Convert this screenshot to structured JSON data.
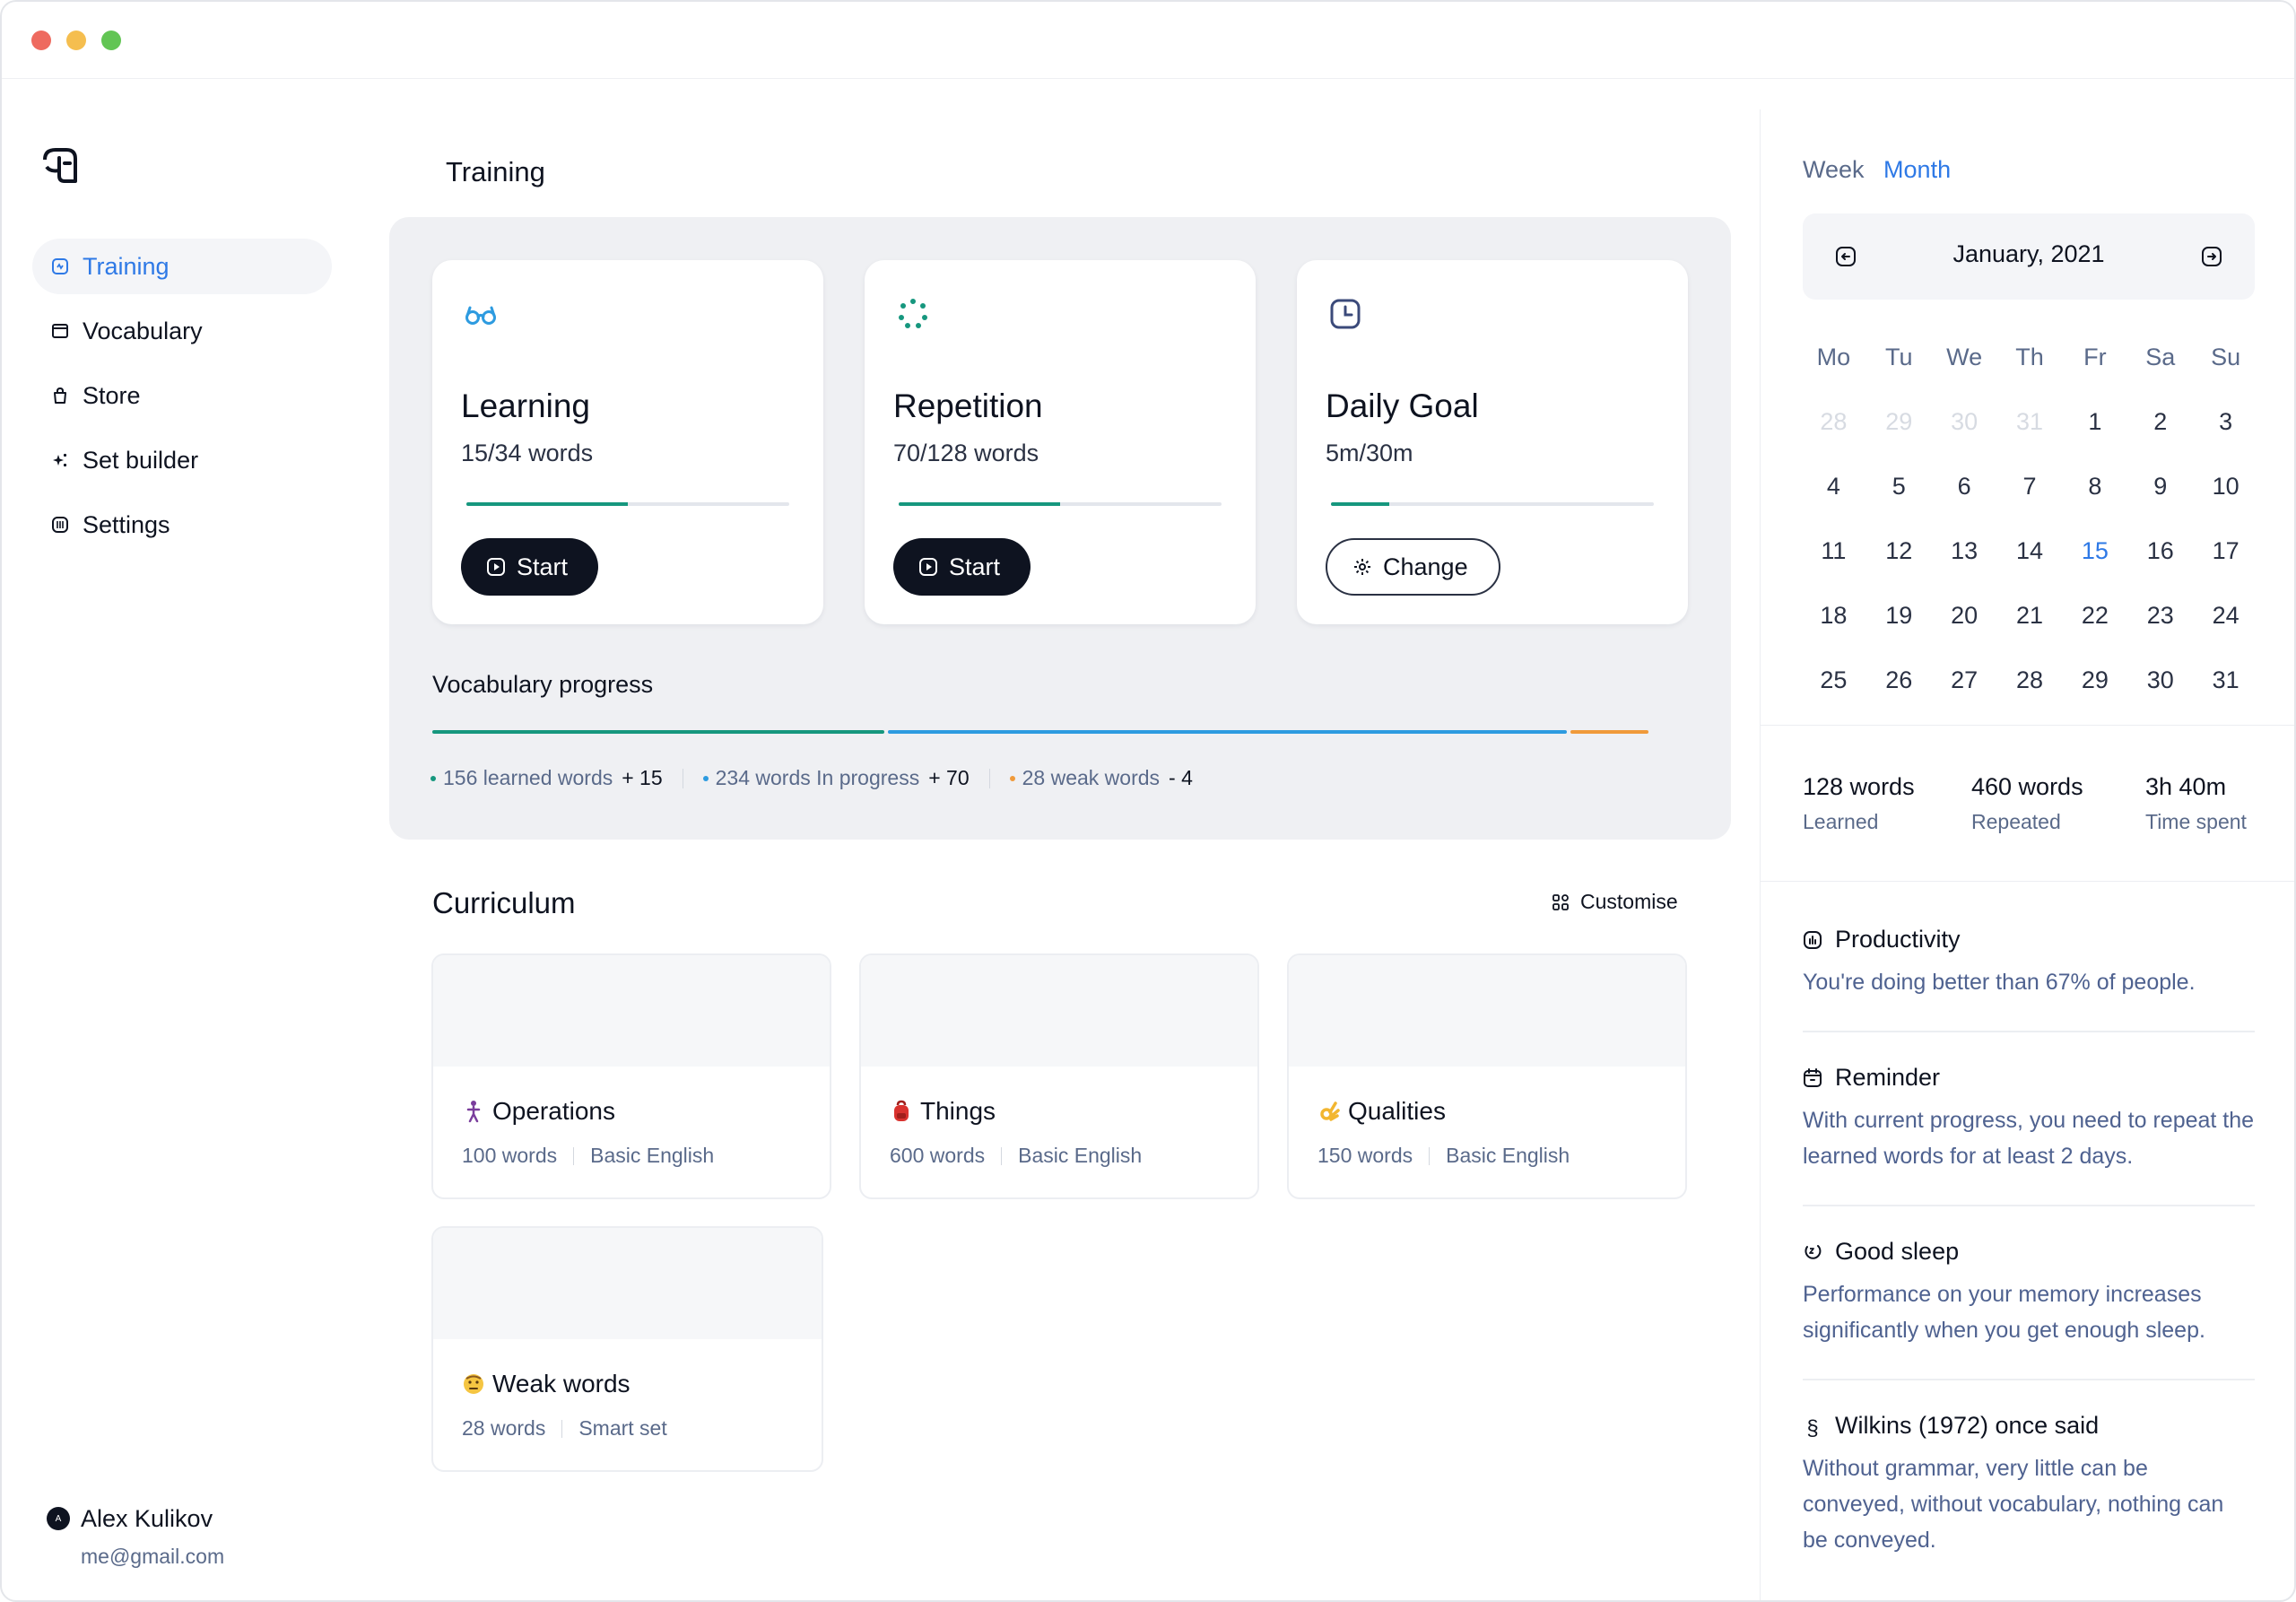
{
  "sidebar": {
    "nav": [
      {
        "label": "Training",
        "icon": "training-icon",
        "active": true
      },
      {
        "label": "Vocabulary",
        "icon": "vocabulary-icon"
      },
      {
        "label": "Store",
        "icon": "bag-icon"
      },
      {
        "label": "Set builder",
        "icon": "sparkle-icon"
      },
      {
        "label": "Settings",
        "icon": "settings-icon"
      }
    ],
    "user": {
      "initial": "A",
      "name": "Alex Kulikov",
      "email": "me@gmail.com"
    }
  },
  "main": {
    "title": "Training",
    "cards": [
      {
        "title": "Learning",
        "sub": "15/34 words",
        "progress": 0.5,
        "button": "Start",
        "icon": "glasses-icon"
      },
      {
        "title": "Repetition",
        "sub": "70/128 words",
        "progress": 0.5,
        "button": "Start",
        "icon": "repeat-dots-icon"
      },
      {
        "title": "Daily Goal",
        "sub": "5m/30m",
        "progress": 0.18,
        "button": "Change",
        "icon": "clock-icon"
      }
    ],
    "vocab": {
      "title": "Vocabulary progress",
      "items": [
        {
          "label": "156 learned words",
          "delta": "+ 15",
          "color": "#16977e",
          "count": 156
        },
        {
          "label": "234 words In progress",
          "delta": "+ 70",
          "color": "#2d9be0",
          "count": 234
        },
        {
          "label": "28 weak words",
          "delta": "- 4",
          "color": "#f09a3a",
          "count": 28
        }
      ]
    },
    "curriculum": {
      "title": "Curriculum",
      "customise": "Customise",
      "cards": [
        {
          "title": "Operations",
          "words": "100 words",
          "tag": "Basic English",
          "emoji": "person-icon"
        },
        {
          "title": "Things",
          "words": "600 words",
          "tag": "Basic English",
          "emoji": "backpack-icon"
        },
        {
          "title": "Qualities",
          "words": "150 words",
          "tag": "Basic English",
          "emoji": "ok-hand-icon"
        },
        {
          "title": "Weak words",
          "words": "28 words",
          "tag": "Smart set",
          "emoji": "face-icon"
        }
      ]
    }
  },
  "right": {
    "tabs": [
      "Week",
      "Month"
    ],
    "active_tab": "Month",
    "month": "January, 2021",
    "dow": [
      "Mo",
      "Tu",
      "We",
      "Th",
      "Fr",
      "Sa",
      "Su"
    ],
    "weeks": [
      [
        "28",
        "29",
        "30",
        "31",
        "1",
        "2",
        "3"
      ],
      [
        "4",
        "5",
        "6",
        "7",
        "8",
        "9",
        "10"
      ],
      [
        "11",
        "12",
        "13",
        "14",
        "15",
        "16",
        "17"
      ],
      [
        "18",
        "19",
        "20",
        "21",
        "22",
        "23",
        "24"
      ],
      [
        "25",
        "26",
        "27",
        "28",
        "29",
        "30",
        "31"
      ]
    ],
    "today": "15",
    "stats": [
      {
        "value": "128 words",
        "label": "Learned"
      },
      {
        "value": "460 words",
        "label": "Repeated"
      },
      {
        "value": "3h 40m",
        "label": "Time spent"
      }
    ],
    "tips": [
      {
        "title": "Productivity",
        "icon": "chart-icon",
        "body": "You're doing better than 67% of people."
      },
      {
        "title": "Reminder",
        "icon": "calendar-icon",
        "body": "With current progress, you need to repeat the learned words for at least 2 days."
      },
      {
        "title": "Good sleep",
        "icon": "sleep-icon",
        "body": "Performance on your memory increases significantly when you get enough sleep."
      },
      {
        "title": "Wilkins (1972) once said",
        "icon": "section-icon",
        "body": "Without grammar, very little can be conveyed, without vocabulary, nothing can be conveyed."
      }
    ]
  },
  "colors": {
    "accent": "#2e79e6",
    "dark": "#0e1320",
    "teal": "#16977e",
    "blue": "#2d9be0",
    "orange": "#f09a3a"
  }
}
